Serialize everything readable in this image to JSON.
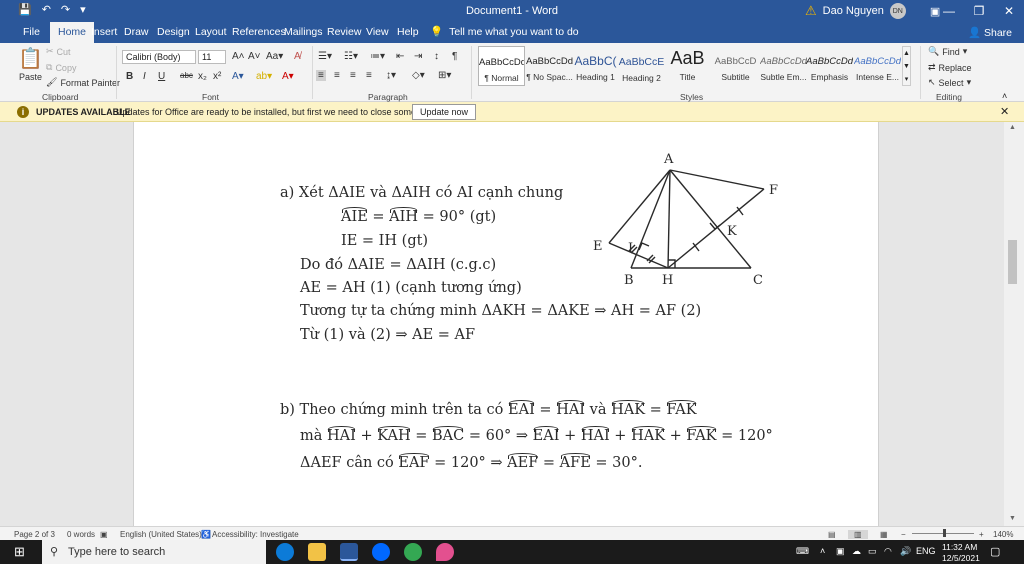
{
  "window": {
    "title": "Document1 - Word",
    "user_name": "Dao Nguyen",
    "user_initials": "DN"
  },
  "tabs": [
    "File",
    "Home",
    "Insert",
    "Draw",
    "Design",
    "Layout",
    "References",
    "Mailings",
    "Review",
    "View",
    "Help"
  ],
  "tell_me": "Tell me what you want to do",
  "share_label": "Share",
  "ribbon": {
    "clipboard": {
      "paste": "Paste",
      "cut": "Cut",
      "copy": "Copy",
      "format_painter": "Format Painter",
      "label": "Clipboard"
    },
    "font": {
      "font_name": "Calibri (Body)",
      "font_size": "11",
      "label": "Font"
    },
    "paragraph": {
      "label": "Paragraph"
    },
    "styles": {
      "label": "Styles",
      "items": [
        {
          "sample": "AaBbCcDd",
          "name": "¶ Normal"
        },
        {
          "sample": "AaBbCcDd",
          "name": "¶ No Spac..."
        },
        {
          "sample": "AaBbC(",
          "name": "Heading 1"
        },
        {
          "sample": "AaBbCcE",
          "name": "Heading 2"
        },
        {
          "sample": "AaB",
          "name": "Title"
        },
        {
          "sample": "AaBbCcD",
          "name": "Subtitle"
        },
        {
          "sample": "AaBbCcDd",
          "name": "Subtle Em..."
        },
        {
          "sample": "AaBbCcDd",
          "name": "Emphasis"
        },
        {
          "sample": "AaBbCcDd",
          "name": "Intense E..."
        }
      ]
    },
    "editing": {
      "find": "Find",
      "replace": "Replace",
      "select": "Select",
      "label": "Editing"
    }
  },
  "updates_bar": {
    "title": "UPDATES AVAILABLE",
    "message": "Updates for Office are ready to be installed, but first we need to close some apps.",
    "button": "Update now"
  },
  "document": {
    "part_a": {
      "l1": "a) Xét ΔAIE và ΔAIH có AI cạnh chung",
      "l2a": "AIE",
      "l2b": "AIH",
      "l2c": "= 90° (gt)",
      "l3": "IE = IH (gt)",
      "l4": "Do đó ΔAIE = ΔAIH (c.g.c)",
      "l5": "AE = AH (1) (cạnh tương ứng)",
      "l6": "Tương tự ta chứng minh ΔAKH = ΔAKE ⇒ AH = AF (2)",
      "l7": "Từ (1) và (2) ⇒ AE = AF"
    },
    "part_b": {
      "l1_pre": "b) Theo chứng minh trên ta có",
      "l1_a": "EAI",
      "l1_b": "HAI",
      "l1_and": "và",
      "l1_c": "HAK",
      "l1_d": "FAK",
      "l2_pre": "mà",
      "l2_a": "HAI",
      "l2_b": "KAH",
      "l2_c": "BAC",
      "l2_val": "= 60° ⇒",
      "l2_d": "EAI",
      "l2_e": "HAI",
      "l2_f": "HAK",
      "l2_g": "FAK",
      "l2_end": "= 120°",
      "l3_pre": "ΔAEF cân có",
      "l3_a": "EAF",
      "l3_val": "= 120° ⇒",
      "l3_b": "AEF",
      "l3_c": "AFE",
      "l3_end": "= 30°."
    },
    "figure_labels": {
      "A": "A",
      "F": "F",
      "E": "E",
      "I": "I",
      "K": "K",
      "B": "B",
      "H": "H",
      "C": "C"
    }
  },
  "status": {
    "page": "Page 2 of 3",
    "words": "0 words",
    "language": "English (United States)",
    "accessibility": "Accessibility: Investigate",
    "zoom": "140%"
  },
  "taskbar": {
    "search": "Type here to search",
    "lang": "ENG",
    "time": "11:32 AM",
    "date": "12/5/2021"
  }
}
